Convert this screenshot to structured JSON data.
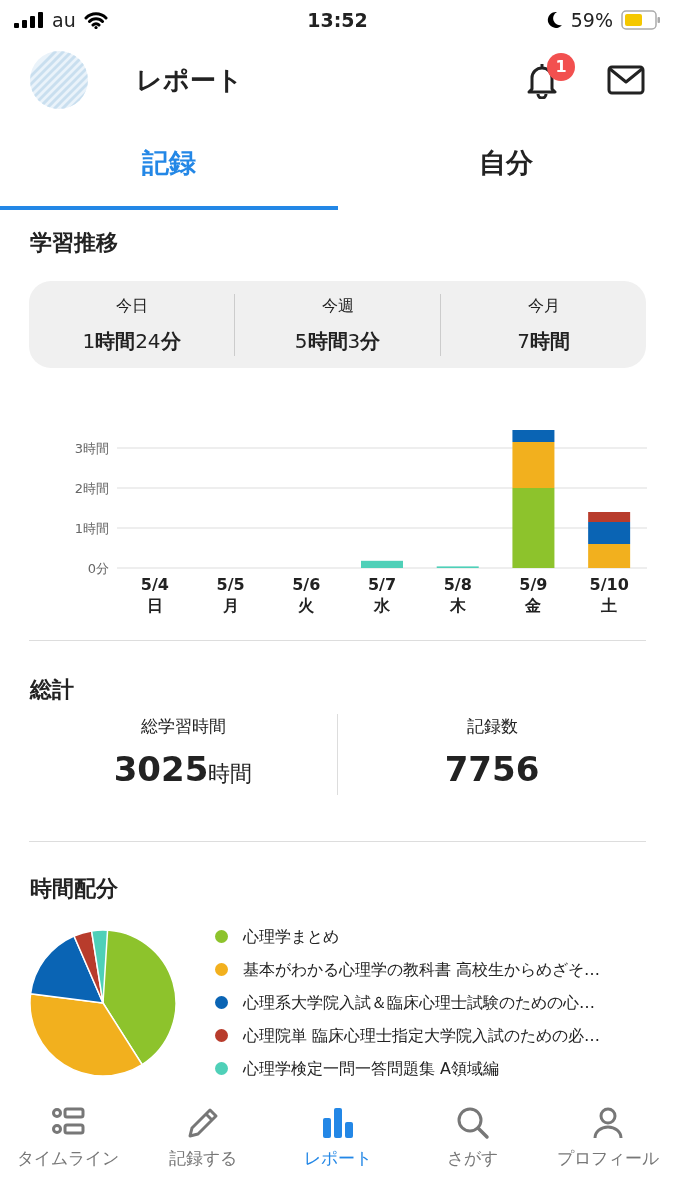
{
  "status_bar": {
    "carrier": "au",
    "time": "13:52",
    "battery": "59%"
  },
  "header": {
    "title": "レポート",
    "notification_count": "1"
  },
  "tabs": [
    {
      "label": "記録",
      "selected": true
    },
    {
      "label": "自分",
      "selected": false
    }
  ],
  "study_trend": {
    "title": "学習推移",
    "summary": [
      {
        "label": "今日",
        "value": "1**時間**24**分**"
      },
      {
        "label": "今週",
        "value": "5**時間**3**分**"
      },
      {
        "label": "今月",
        "value": "7**時間**"
      }
    ],
    "chart_data": {
      "type": "bar",
      "stacked": true,
      "categories": [
        "5/4 日",
        "5/5 月",
        "5/6 火",
        "5/7 水",
        "5/8 木",
        "5/9 金",
        "5/10 土"
      ],
      "ylim": [
        0,
        3.5
      ],
      "grid": true,
      "yticks": [
        {
          "value": 0,
          "label": "0分"
        },
        {
          "value": 1,
          "label": "1時間"
        },
        {
          "value": 2,
          "label": "2時間"
        },
        {
          "value": 3,
          "label": "3時間"
        }
      ],
      "series": [
        {
          "color": "#8dc32c",
          "values": [
            0,
            0,
            0,
            0,
            0,
            2.0,
            0
          ]
        },
        {
          "color": "#f2b01e",
          "values": [
            0,
            0,
            0,
            0,
            0,
            1.15,
            0.6
          ]
        },
        {
          "color": "#0a64b4",
          "values": [
            0,
            0,
            0,
            0,
            0,
            0.3,
            0.55
          ]
        },
        {
          "color": "#b83c2c",
          "values": [
            0,
            0,
            0,
            0,
            0,
            0,
            0.25
          ]
        },
        {
          "color": "#4fd0b8",
          "values": [
            0,
            0,
            0,
            0.18,
            0.04,
            0,
            0
          ]
        }
      ]
    }
  },
  "totals": {
    "title": "総計",
    "stats": [
      {
        "label": "総学習時間",
        "value": "3025",
        "unit": "時間"
      },
      {
        "label": "記録数",
        "value": "7756"
      }
    ]
  },
  "allocation": {
    "title": "時間配分",
    "items": [
      {
        "name": "心理学まとめ",
        "color": "#8dc32c"
      },
      {
        "name": "基本がわかる心理学の教科書 高校生からめざそ…",
        "color": "#f2b01e"
      },
      {
        "name": "心理系大学院入試＆臨床心理士試験のための心…",
        "color": "#0a64b4"
      },
      {
        "name": "心理院単 臨床心理士指定大学院入試のための必…",
        "color": "#b83c2c"
      },
      {
        "name": "心理学検定一問一答問題集 A領域編",
        "color": "#4fd0b8"
      }
    ]
  },
  "bottom_nav": [
    {
      "label": "タイムライン",
      "selected": false
    },
    {
      "label": "記録する",
      "selected": false
    },
    {
      "label": "レポート",
      "selected": true
    },
    {
      "label": "さがす",
      "selected": false
    },
    {
      "label": "プロフィール",
      "selected": false
    }
  ]
}
